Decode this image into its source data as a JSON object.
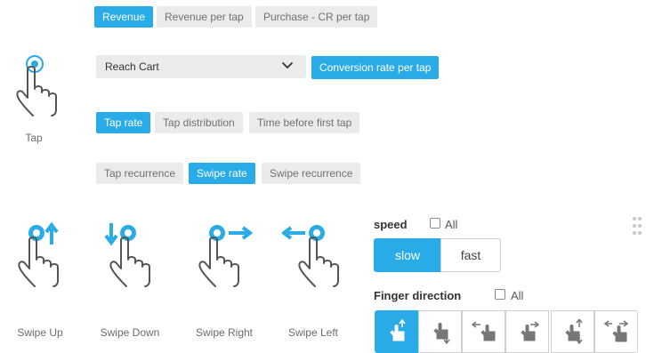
{
  "metric_tabs": {
    "row1": [
      "Revenue",
      "Revenue per tap",
      "Purchase - CR per tap"
    ],
    "row2_select_value": "Reach Cart",
    "row2_button": "Conversion rate per tap",
    "row3": [
      "Tap rate",
      "Tap distribution",
      "Time before first tap"
    ],
    "row4": [
      "Tap recurrence",
      "Swipe rate",
      "Swipe recurrence"
    ]
  },
  "gestures": {
    "tap": "Tap",
    "swipe_up": "Swipe Up",
    "swipe_down": "Swipe Down",
    "swipe_right": "Swipe Right",
    "swipe_left": "Swipe Left"
  },
  "speed": {
    "label": "speed",
    "all_label": "All",
    "options": [
      "slow",
      "fast"
    ],
    "selected": "slow"
  },
  "finger_direction": {
    "label": "Finger direction",
    "all_label": "All",
    "selected_index": 0
  },
  "colors": {
    "accent": "#29abe8",
    "chip_bg": "#ebebeb",
    "chip_text": "#707070"
  }
}
